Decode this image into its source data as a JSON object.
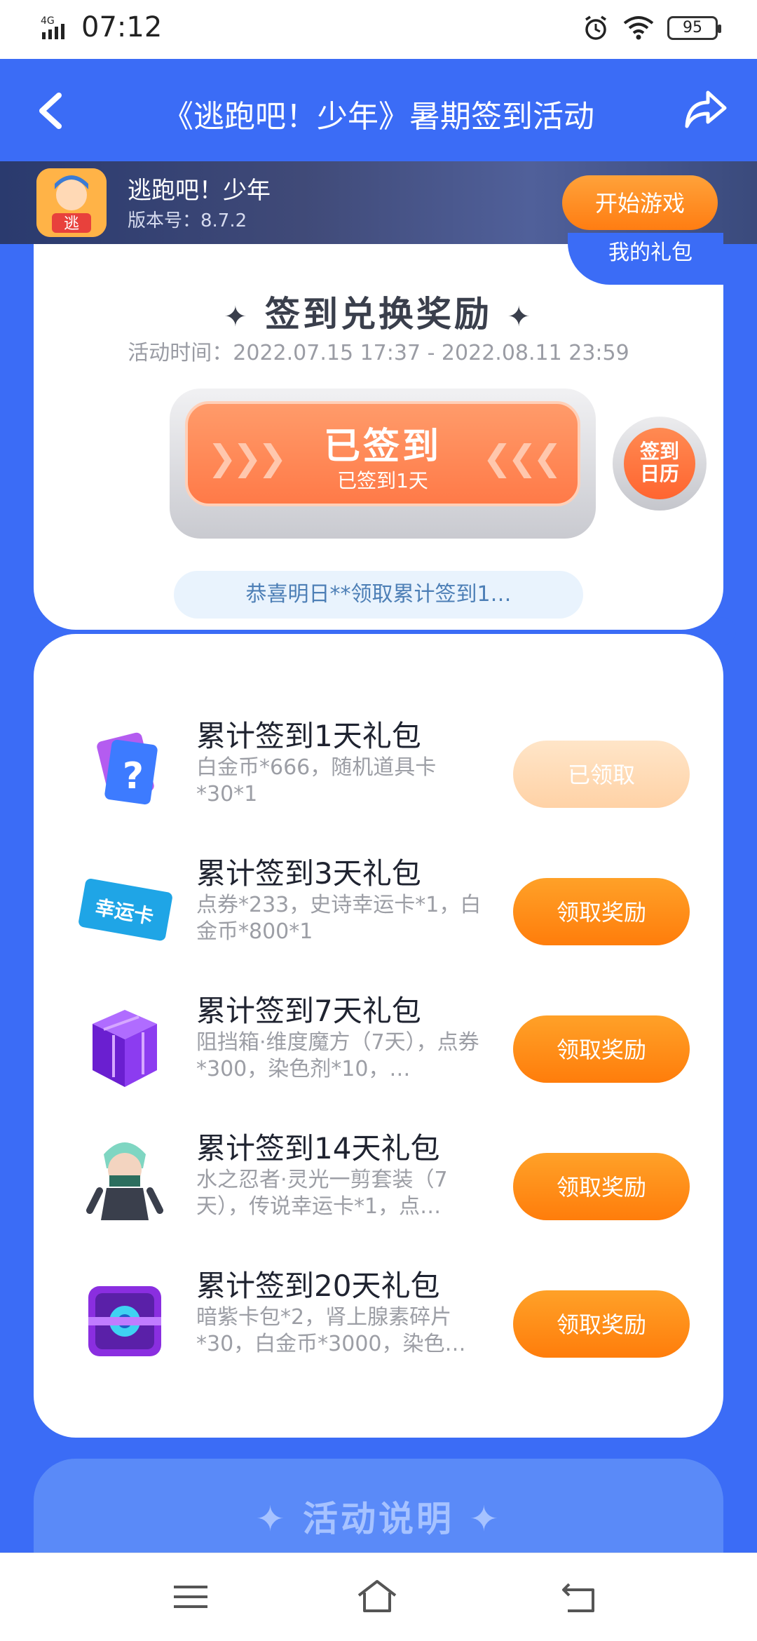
{
  "status_bar": {
    "network": "4G",
    "time": "07:12",
    "battery": "95"
  },
  "header": {
    "title": "《逃跑吧！少年》暑期签到活动"
  },
  "game_bar": {
    "name": "逃跑吧！少年",
    "version": "版本号：8.7.2",
    "start_label": "开始游戏",
    "icon_text": "逃"
  },
  "signin": {
    "my_gifts": "我的礼包",
    "section_title": "签到兑换奖励",
    "activity_time": "活动时间：2022.07.15 17:37 - 2022.08.11 23:59",
    "signed_label": "已签到",
    "signed_days": "已签到1天",
    "calendar_label_1": "签到",
    "calendar_label_2": "日历",
    "notice": "恭喜明日**领取累计签到1…"
  },
  "gifts": [
    {
      "name": "累计签到1天礼包",
      "desc": "白金币*666，随机道具卡*30*1",
      "button": "已领取",
      "claimed": true,
      "icon": "mystery-card-icon"
    },
    {
      "name": "累计签到3天礼包",
      "desc": "点券*233，史诗幸运卡*1，白金币*800*1",
      "button": "领取奖励",
      "claimed": false,
      "icon": "lucky-card-icon",
      "icon_text": "幸运卡"
    },
    {
      "name": "累计签到7天礼包",
      "desc": "阻挡箱·维度魔方（7天），点券*300，染色剂*10，…",
      "button": "领取奖励",
      "claimed": false,
      "icon": "purple-cube-icon"
    },
    {
      "name": "累计签到14天礼包",
      "desc": "水之忍者·灵光一剪套装（7天），传说幸运卡*1，点…",
      "button": "领取奖励",
      "claimed": false,
      "icon": "ninja-character-icon"
    },
    {
      "name": "累计签到20天礼包",
      "desc": "暗紫卡包*2，肾上腺素碎片*30，白金币*3000，染色…",
      "button": "领取奖励",
      "claimed": false,
      "icon": "card-pack-icon"
    }
  ],
  "info": {
    "title": "活动说明"
  },
  "colors": {
    "primary_blue": "#3b6cf6",
    "orange": "#ff7d0b",
    "signed_orange": "#ff7a48"
  }
}
